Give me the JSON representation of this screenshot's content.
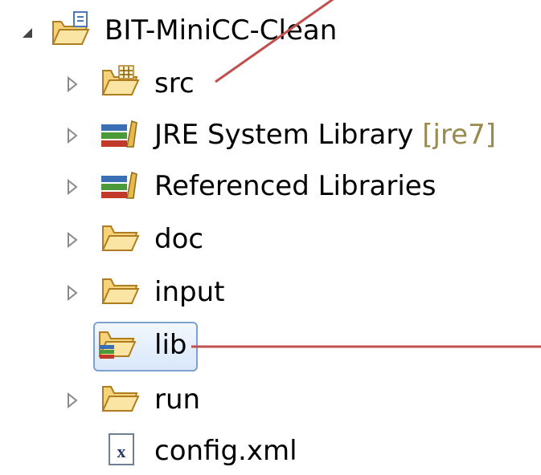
{
  "tree": {
    "project": {
      "label": "BIT-MiniCC-Clean"
    },
    "items": [
      {
        "label": "src"
      },
      {
        "label": "JRE System Library",
        "decorator": "[jre7]"
      },
      {
        "label": "Referenced Libraries"
      },
      {
        "label": "doc"
      },
      {
        "label": "input"
      },
      {
        "label": "lib"
      },
      {
        "label": "run"
      },
      {
        "label": "config.xml"
      }
    ]
  },
  "colors": {
    "folder_fill": "#f6d27a",
    "folder_stroke": "#b07d1e",
    "selection_border": "#7da2ce",
    "annotation_line": "#c0504d",
    "decorator_text": "#9a8a4e"
  },
  "icons": {
    "project": "project-folder-icon",
    "source": "source-folder-icon",
    "library": "library-icon",
    "folder": "folder-icon",
    "xml": "xml-file-icon",
    "expanded": "expanded-triangle-icon",
    "collapsed": "collapsed-triangle-icon"
  }
}
